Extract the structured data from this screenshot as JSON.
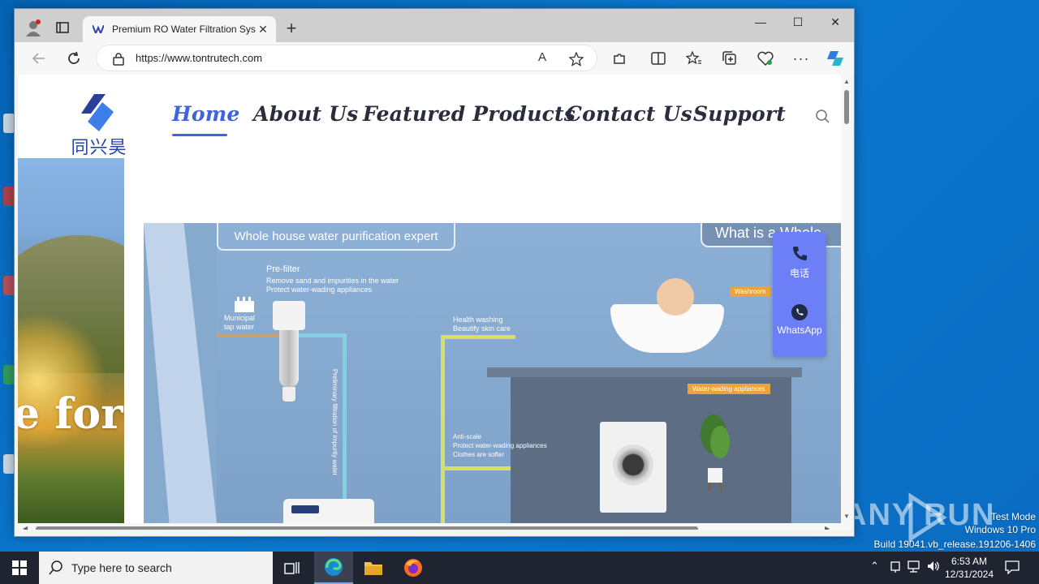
{
  "browser": {
    "tab_title": "Premium RO Water Filtration Sys",
    "url": "https://www.tontrutech.com",
    "new_tab_symbol": "+",
    "close_symbol": "✕",
    "minimize_symbol": "—",
    "maximize_symbol": "☐"
  },
  "site": {
    "logo_text": "同兴昊创",
    "nav": [
      "Home",
      "About Us",
      "Featured Products",
      "Contact Us",
      "Support"
    ],
    "active_nav": "Home",
    "hero_text": "e for",
    "banner": {
      "tag_left": "Whole house water purification expert",
      "tag_right": "What is a Whole",
      "prefilter_title": "Pre-filter",
      "prefilter_lines": [
        "Remove sand and impurities in the water",
        "Protect water-wading appliances"
      ],
      "municipal": [
        "Municipal",
        "tap water"
      ],
      "vertical_text": "Preliminary filtration of impurity water",
      "health_lines": [
        "Health washing",
        "Beautify skin care"
      ],
      "washroom": "Washroom",
      "water_appliances": "Water-wading appliances",
      "antiscale_lines": [
        "Anti-scale",
        "Protect water-wading appliances",
        "Clothes are softer"
      ]
    },
    "contact": [
      {
        "label": "电话",
        "icon": "phone-icon"
      },
      {
        "label": "WhatsApp",
        "icon": "whatsapp-icon"
      }
    ]
  },
  "desktop": {
    "watermark_lines": [
      "Test Mode",
      "Windows 10 Pro",
      "Build 19041.vb_release.191206-1406"
    ],
    "anyrun_text": "ANY RUN"
  },
  "taskbar": {
    "search_placeholder": "Type here to search",
    "time": "6:53 AM",
    "date": "12/31/2024"
  },
  "colors": {
    "accent": "#3e63dc",
    "contact_widget": "#6d7ff6",
    "desktop": "#0a70c8"
  }
}
